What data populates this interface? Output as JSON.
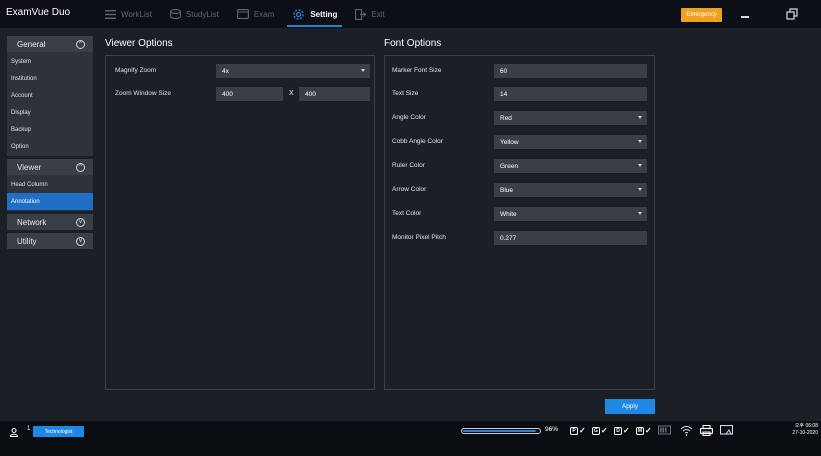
{
  "app": {
    "title": "ExamVue Duo"
  },
  "nav": {
    "items": [
      {
        "label": "WorkList",
        "icon": "list-icon"
      },
      {
        "label": "StudyList",
        "icon": "database-icon"
      },
      {
        "label": "Exam",
        "icon": "monitor-icon"
      },
      {
        "label": "Setting",
        "icon": "gear-icon",
        "active": true
      },
      {
        "label": "Exit",
        "icon": "exit-icon"
      }
    ]
  },
  "window": {
    "emergency_label": "Emergency"
  },
  "sidebar": {
    "groups": [
      {
        "label": "General",
        "expanded": true,
        "items": [
          "System",
          "Institution",
          "Account",
          "Display",
          "Backup",
          "Option"
        ]
      },
      {
        "label": "Viewer",
        "expanded": true,
        "items": [
          "Head Column",
          "Annotation"
        ],
        "active_item": "Annotation"
      },
      {
        "label": "Network",
        "expanded": false,
        "items": []
      },
      {
        "label": "Utility",
        "expanded": false,
        "items": []
      }
    ]
  },
  "viewer_options": {
    "title": "Viewer Options",
    "magnify_zoom_label": "Magnify Zoom",
    "magnify_zoom_value": "4x",
    "zoom_window_size_label": "Zoom Window Size",
    "zoom_width": "400",
    "zoom_separator": "X",
    "zoom_height": "400"
  },
  "font_options": {
    "title": "Font Options",
    "rows": [
      {
        "label": "Marker Font Size",
        "value": "60",
        "type": "input"
      },
      {
        "label": "Text Size",
        "value": "14",
        "type": "input"
      },
      {
        "label": "Angle Color",
        "value": "Red",
        "type": "select"
      },
      {
        "label": "Cobb Angle Color",
        "value": "Yellow",
        "type": "select"
      },
      {
        "label": "Ruler Color",
        "value": "Green",
        "type": "select"
      },
      {
        "label": "Arrow Color",
        "value": "Blue",
        "type": "select"
      },
      {
        "label": "Text Color",
        "value": "White",
        "type": "select"
      },
      {
        "label": "Monitor Pixel Pitch",
        "value": "0.277",
        "type": "input"
      }
    ]
  },
  "actions": {
    "apply_label": "Apply"
  },
  "statusbar": {
    "user_count": "1",
    "role": "Technologist",
    "progress_percent": 96,
    "progress_text": "96%",
    "devices": [
      {
        "letter": "P",
        "icon": "device-p-icon"
      },
      {
        "letter": "G",
        "icon": "device-g-icon"
      },
      {
        "letter": "D",
        "icon": "device-d-icon"
      },
      {
        "letter": "M",
        "icon": "device-m-icon"
      }
    ],
    "time": "오후 06:08",
    "date": "27-10-2020"
  },
  "colors": {
    "accent": "#1e88e5",
    "emergency": "#f0a020",
    "sidebar_active": "#1f6fc6",
    "panel_bg": "#1b1f26",
    "field_bg": "#3a3f47"
  }
}
